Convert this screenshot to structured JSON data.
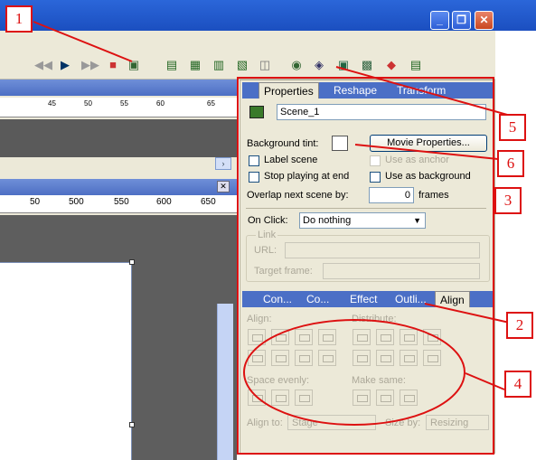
{
  "window": {
    "minimize_glyph": "_",
    "restore_glyph": "❐",
    "close_glyph": "✕"
  },
  "toolbar": {
    "icons": [
      "rewind-icon",
      "play-icon",
      "forward-icon",
      "stop-icon",
      "scene-icon",
      "add-scene-icon",
      "insert-icon",
      "delete-icon",
      "duplicate-icon",
      "hide-icon",
      "globe-icon",
      "layer-icon",
      "symbol-icon",
      "frame-icon",
      "tween-icon",
      "text-icon"
    ]
  },
  "timeline": {
    "ruler_labels": [
      "45",
      "50",
      "55",
      "60",
      "65"
    ],
    "close_glyph": "✕",
    "scroll_glyph": "›"
  },
  "stage": {
    "ruler_labels": [
      "50",
      "500",
      "550",
      "600",
      "650"
    ]
  },
  "properties": {
    "tabs": [
      "Properties",
      "Reshape",
      "Transform"
    ],
    "scene_name": "Scene_1",
    "background_tint_label": "Background tint:",
    "movie_properties_button": "Movie Properties...",
    "label_scene": "Label scene",
    "use_as_anchor": "Use as anchor",
    "stop_playing_at_end": "Stop playing at end",
    "use_as_background": "Use as background",
    "overlap_label": "Overlap next scene by:",
    "overlap_value": "0",
    "overlap_unit": "frames",
    "on_click_label": "On Click:",
    "on_click_value": "Do nothing",
    "link_group": "Link",
    "url_label": "URL:",
    "target_frame_label": "Target frame:"
  },
  "align_panel": {
    "tabs": [
      "Con...",
      "Co...",
      "Effect",
      "Outli...",
      "Align"
    ],
    "align_label": "Align:",
    "distribute_label": "Distribute:",
    "space_evenly_label": "Space evenly:",
    "make_same_label": "Make same:",
    "align_to_label": "Align to:",
    "align_to_value": "Stage",
    "size_by_label": "Size by:",
    "size_by_value": "Resizing"
  },
  "annotations": [
    "1",
    "2",
    "3",
    "4",
    "5",
    "6"
  ]
}
